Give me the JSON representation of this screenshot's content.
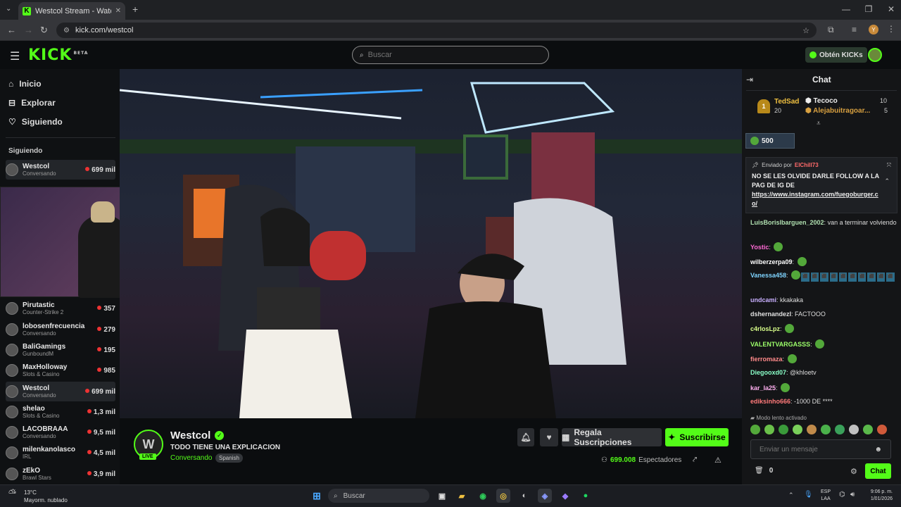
{
  "browser": {
    "tab_title": "Westcol Stream - Watch Li",
    "new_tab": "+",
    "url": "kick.com/westcol",
    "profile_initial": "Y"
  },
  "header": {
    "logo": "KICK",
    "logo_badge": "BETA",
    "search_placeholder": "Buscar",
    "kicks_label": "Obtén KICKs"
  },
  "sidebar": {
    "nav": [
      {
        "label": "Inicio",
        "icon": "home-icon"
      },
      {
        "label": "Explorar",
        "icon": "compass-icon"
      },
      {
        "label": "Siguiendo",
        "icon": "heart-icon"
      }
    ],
    "section_title": "Siguiendo",
    "following": [
      {
        "name": "Westcol",
        "category": "Conversando",
        "viewers": "699 mil"
      }
    ],
    "channels": [
      {
        "name": "Pirutastic",
        "category": "Counter-Strike 2",
        "viewers": "357"
      },
      {
        "name": "lobosenfrecuencia",
        "category": "Conversando",
        "viewers": "279"
      },
      {
        "name": "BaliGamings",
        "category": "GunboundM",
        "viewers": "195"
      },
      {
        "name": "MaxHolloway",
        "category": "Slots & Casino",
        "viewers": "985"
      },
      {
        "name": "Westcol",
        "category": "Conversando",
        "viewers": "699 mil"
      },
      {
        "name": "shelao",
        "category": "Slots & Casino",
        "viewers": "1,3 mil"
      },
      {
        "name": "LACOBRAAA",
        "category": "Conversando",
        "viewers": "9,5 mil"
      },
      {
        "name": "milenkanolasco",
        "category": "IRL",
        "viewers": "4,5 mil"
      },
      {
        "name": "zEkO",
        "category": "Brawl Stars",
        "viewers": "3,9 mil"
      }
    ]
  },
  "stream": {
    "streamer": "Westcol",
    "title": "TODO TIENE UNA EXPLICACION",
    "category": "Conversando",
    "language": "Spanish",
    "live": "LIVE",
    "gift_label": "Regala Suscripciones",
    "subscribe_label": "Suscribirse",
    "viewers": "699.008",
    "viewers_label": "Espectadores"
  },
  "chat": {
    "title": "Chat",
    "leaderboard": [
      {
        "rank": "1",
        "name": "TedSad",
        "value": "20"
      },
      {
        "name": "Tecoco",
        "value": "10"
      },
      {
        "name": "Alejabuitragoar...",
        "value": "5"
      }
    ],
    "kicks_goal": "500",
    "pinned_by": "Enviado por",
    "pinned_user": "ElChill73",
    "pinned_text": "NO SE LES OLVIDE DARLE FOLLOW A LA PAG DE IG DE",
    "pinned_link": "https://www.instagram.com/fuegoburger.co/",
    "messages": [
      {
        "user": "LuisBorislbarguen_2002",
        "text": "van a terminar volviendo",
        "color": "#b0e0b0"
      },
      {
        "user": "Yostic",
        "text": "",
        "color": "#ff6ad5",
        "emote": true
      },
      {
        "user": "wilberzerpa09",
        "text": "",
        "color": "#ffffff",
        "emote": true
      },
      {
        "user": "Vanessa458",
        "text": "",
        "color": "#7fd4ff",
        "emote": true,
        "spam": true
      },
      {
        "user": "undcami",
        "text": "kkakaka",
        "color": "#c9b0ff"
      },
      {
        "user": "dshernandezl",
        "text": "FACTOOO",
        "color": "#e0e0e0"
      },
      {
        "user": "c4rlosLpz",
        "text": "",
        "color": "#d8ff8a",
        "emote": true
      },
      {
        "user": "VALENTVARGASSS",
        "text": "",
        "color": "#9cff6a",
        "emote": true
      },
      {
        "user": "fierromaza",
        "text": "",
        "color": "#ff8a8a",
        "emote": true
      },
      {
        "user": "Diegooxd07",
        "text": "@khloetv",
        "color": "#8affc8"
      },
      {
        "user": "kar_la25",
        "text": "",
        "color": "#ffb0f0",
        "emote": true
      },
      {
        "user": "ediksinho666",
        "text": "-1000 DE ****",
        "color": "#ff7a7a"
      }
    ],
    "slow_mode": "Modo lento activado",
    "input_placeholder": "Enviar un mensaje",
    "points": "0",
    "send_label": "Chat"
  },
  "taskbar": {
    "weather_temp": "13°C",
    "weather_desc": "Mayorm. nublado",
    "search_placeholder": "Buscar",
    "lang": "ESP",
    "lang2": "LAA",
    "time": "9:06 p. m.",
    "date": "1/01/2026"
  }
}
